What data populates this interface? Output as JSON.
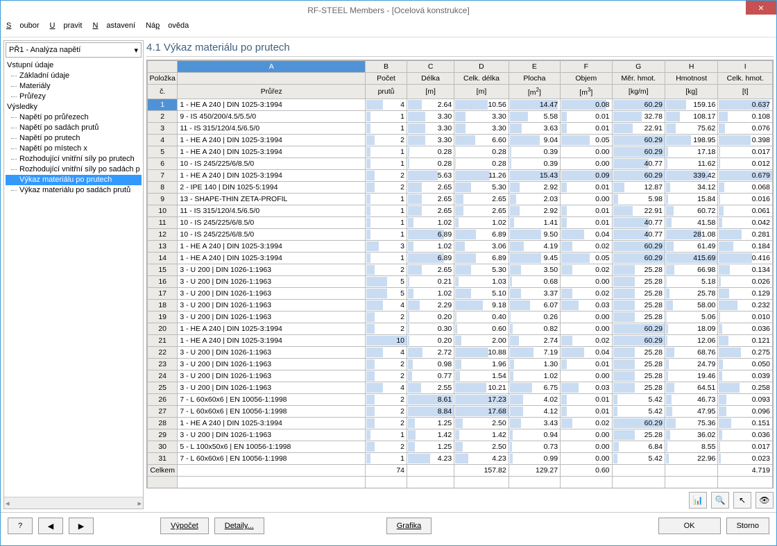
{
  "window": {
    "title": "RF-STEEL Members - [Ocelová konstrukce]"
  },
  "menu": {
    "soubor": "Soubor",
    "upravit": "Upravit",
    "nastaveni": "Nastavení",
    "napoveda": "Nápověda"
  },
  "combo": {
    "value": "PŘ1 - Analýza napětí"
  },
  "tree": {
    "vstup": "Vstupní údaje",
    "zaklad": "Základní údaje",
    "materialy": "Materiály",
    "prurezy": "Průřezy",
    "vysledky": "Výsledky",
    "np_prurez": "Napětí po průřezech",
    "np_sadach": "Napětí po sadách prutů",
    "np_prutech": "Napětí po prutech",
    "np_mistech": "Napětí po místech x",
    "roz_prutech": "Rozhodující vnitřní síly po prutech",
    "roz_sadach": "Rozhodující vnitřní síly po sadách p",
    "vykaz_prut": "Výkaz materiálu po prutech",
    "vykaz_sad": "Výkaz materiálu po sadách prutů"
  },
  "heading": "4.1 Výkaz materiálu po prutech",
  "cols": {
    "letters": [
      "",
      "A",
      "B",
      "C",
      "D",
      "E",
      "F",
      "G",
      "H",
      "I"
    ],
    "h1": [
      "Položka",
      "",
      "Počet",
      "Délka",
      "Celk. délka",
      "Plocha",
      "Objem",
      "Měr. hmot.",
      "Hmotnost",
      "Celk. hmot."
    ],
    "h2": [
      "č.",
      "Průřez",
      "prutů",
      "[m]",
      "[m]",
      "[m2]",
      "[m3]",
      "[kg/m]",
      "[kg]",
      "[t]"
    ]
  },
  "rows": [
    {
      "n": "1",
      "sec": "1 - HE A 240 | DIN 1025-3:1994",
      "cnt": "4",
      "len": "2.64",
      "tot": "10.56",
      "area": "14.47",
      "vol": "0.08",
      "unit": "60.29",
      "mass": "159.16",
      "tmass": "0.637"
    },
    {
      "n": "2",
      "sec": "9 - IS 450/200/4.5/5.5/0",
      "cnt": "1",
      "len": "3.30",
      "tot": "3.30",
      "area": "5.58",
      "vol": "0.01",
      "unit": "32.78",
      "mass": "108.17",
      "tmass": "0.108"
    },
    {
      "n": "3",
      "sec": "11 - IS 315/120/4.5/6.5/0",
      "cnt": "1",
      "len": "3.30",
      "tot": "3.30",
      "area": "3.63",
      "vol": "0.01",
      "unit": "22.91",
      "mass": "75.62",
      "tmass": "0.076"
    },
    {
      "n": "4",
      "sec": "1 - HE A 240 | DIN 1025-3:1994",
      "cnt": "2",
      "len": "3.30",
      "tot": "6.60",
      "area": "9.04",
      "vol": "0.05",
      "unit": "60.29",
      "mass": "198.95",
      "tmass": "0.398"
    },
    {
      "n": "5",
      "sec": "1 - HE A 240 | DIN 1025-3:1994",
      "cnt": "1",
      "len": "0.28",
      "tot": "0.28",
      "area": "0.39",
      "vol": "0.00",
      "unit": "60.29",
      "mass": "17.18",
      "tmass": "0.017"
    },
    {
      "n": "6",
      "sec": "10 - IS 245/225/6/8.5/0",
      "cnt": "1",
      "len": "0.28",
      "tot": "0.28",
      "area": "0.39",
      "vol": "0.00",
      "unit": "40.77",
      "mass": "11.62",
      "tmass": "0.012"
    },
    {
      "n": "7",
      "sec": "1 - HE A 240 | DIN 1025-3:1994",
      "cnt": "2",
      "len": "5.63",
      "tot": "11.26",
      "area": "15.43",
      "vol": "0.09",
      "unit": "60.29",
      "mass": "339.42",
      "tmass": "0.679"
    },
    {
      "n": "8",
      "sec": "2 - IPE 140 | DIN 1025-5:1994",
      "cnt": "2",
      "len": "2.65",
      "tot": "5.30",
      "area": "2.92",
      "vol": "0.01",
      "unit": "12.87",
      "mass": "34.12",
      "tmass": "0.068"
    },
    {
      "n": "9",
      "sec": "13 - SHAPE-THIN ZETA-PROFIL",
      "cnt": "1",
      "len": "2.65",
      "tot": "2.65",
      "area": "2.03",
      "vol": "0.00",
      "unit": "5.98",
      "mass": "15.84",
      "tmass": "0.016"
    },
    {
      "n": "10",
      "sec": "11 - IS 315/120/4.5/6.5/0",
      "cnt": "1",
      "len": "2.65",
      "tot": "2.65",
      "area": "2.92",
      "vol": "0.01",
      "unit": "22.91",
      "mass": "60.72",
      "tmass": "0.061"
    },
    {
      "n": "11",
      "sec": "10 - IS 245/225/6/8.5/0",
      "cnt": "1",
      "len": "1.02",
      "tot": "1.02",
      "area": "1.41",
      "vol": "0.01",
      "unit": "40.77",
      "mass": "41.58",
      "tmass": "0.042"
    },
    {
      "n": "12",
      "sec": "10 - IS 245/225/6/8.5/0",
      "cnt": "1",
      "len": "6.89",
      "tot": "6.89",
      "area": "9.50",
      "vol": "0.04",
      "unit": "40.77",
      "mass": "281.08",
      "tmass": "0.281"
    },
    {
      "n": "13",
      "sec": "1 - HE A 240 | DIN 1025-3:1994",
      "cnt": "3",
      "len": "1.02",
      "tot": "3.06",
      "area": "4.19",
      "vol": "0.02",
      "unit": "60.29",
      "mass": "61.49",
      "tmass": "0.184"
    },
    {
      "n": "14",
      "sec": "1 - HE A 240 | DIN 1025-3:1994",
      "cnt": "1",
      "len": "6.89",
      "tot": "6.89",
      "area": "9.45",
      "vol": "0.05",
      "unit": "60.29",
      "mass": "415.69",
      "tmass": "0.416"
    },
    {
      "n": "15",
      "sec": "3 - U 200 | DIN 1026-1:1963",
      "cnt": "2",
      "len": "2.65",
      "tot": "5.30",
      "area": "3.50",
      "vol": "0.02",
      "unit": "25.28",
      "mass": "66.98",
      "tmass": "0.134"
    },
    {
      "n": "16",
      "sec": "3 - U 200 | DIN 1026-1:1963",
      "cnt": "5",
      "len": "0.21",
      "tot": "1.03",
      "area": "0.68",
      "vol": "0.00",
      "unit": "25.28",
      "mass": "5.18",
      "tmass": "0.026"
    },
    {
      "n": "17",
      "sec": "3 - U 200 | DIN 1026-1:1963",
      "cnt": "5",
      "len": "1.02",
      "tot": "5.10",
      "area": "3.37",
      "vol": "0.02",
      "unit": "25.28",
      "mass": "25.78",
      "tmass": "0.129"
    },
    {
      "n": "18",
      "sec": "3 - U 200 | DIN 1026-1:1963",
      "cnt": "4",
      "len": "2.29",
      "tot": "9.18",
      "area": "6.07",
      "vol": "0.03",
      "unit": "25.28",
      "mass": "58.00",
      "tmass": "0.232"
    },
    {
      "n": "19",
      "sec": "3 - U 200 | DIN 1026-1:1963",
      "cnt": "2",
      "len": "0.20",
      "tot": "0.40",
      "area": "0.26",
      "vol": "0.00",
      "unit": "25.28",
      "mass": "5.06",
      "tmass": "0.010"
    },
    {
      "n": "20",
      "sec": "1 - HE A 240 | DIN 1025-3:1994",
      "cnt": "2",
      "len": "0.30",
      "tot": "0.60",
      "area": "0.82",
      "vol": "0.00",
      "unit": "60.29",
      "mass": "18.09",
      "tmass": "0.036"
    },
    {
      "n": "21",
      "sec": "1 - HE A 240 | DIN 1025-3:1994",
      "cnt": "10",
      "len": "0.20",
      "tot": "2.00",
      "area": "2.74",
      "vol": "0.02",
      "unit": "60.29",
      "mass": "12.06",
      "tmass": "0.121"
    },
    {
      "n": "22",
      "sec": "3 - U 200 | DIN 1026-1:1963",
      "cnt": "4",
      "len": "2.72",
      "tot": "10.88",
      "area": "7.19",
      "vol": "0.04",
      "unit": "25.28",
      "mass": "68.76",
      "tmass": "0.275"
    },
    {
      "n": "23",
      "sec": "3 - U 200 | DIN 1026-1:1963",
      "cnt": "2",
      "len": "0.98",
      "tot": "1.96",
      "area": "1.30",
      "vol": "0.01",
      "unit": "25.28",
      "mass": "24.79",
      "tmass": "0.050"
    },
    {
      "n": "24",
      "sec": "3 - U 200 | DIN 1026-1:1963",
      "cnt": "2",
      "len": "0.77",
      "tot": "1.54",
      "area": "1.02",
      "vol": "0.00",
      "unit": "25.28",
      "mass": "19.46",
      "tmass": "0.039"
    },
    {
      "n": "25",
      "sec": "3 - U 200 | DIN 1026-1:1963",
      "cnt": "4",
      "len": "2.55",
      "tot": "10.21",
      "area": "6.75",
      "vol": "0.03",
      "unit": "25.28",
      "mass": "64.51",
      "tmass": "0.258"
    },
    {
      "n": "26",
      "sec": "7 - L 60x60x6 | EN 10056-1:1998",
      "cnt": "2",
      "len": "8.61",
      "tot": "17.23",
      "area": "4.02",
      "vol": "0.01",
      "unit": "5.42",
      "mass": "46.73",
      "tmass": "0.093"
    },
    {
      "n": "27",
      "sec": "7 - L 60x60x6 | EN 10056-1:1998",
      "cnt": "2",
      "len": "8.84",
      "tot": "17.68",
      "area": "4.12",
      "vol": "0.01",
      "unit": "5.42",
      "mass": "47.95",
      "tmass": "0.096"
    },
    {
      "n": "28",
      "sec": "1 - HE A 240 | DIN 1025-3:1994",
      "cnt": "2",
      "len": "1.25",
      "tot": "2.50",
      "area": "3.43",
      "vol": "0.02",
      "unit": "60.29",
      "mass": "75.36",
      "tmass": "0.151"
    },
    {
      "n": "29",
      "sec": "3 - U 200 | DIN 1026-1:1963",
      "cnt": "1",
      "len": "1.42",
      "tot": "1.42",
      "area": "0.94",
      "vol": "0.00",
      "unit": "25.28",
      "mass": "36.02",
      "tmass": "0.036"
    },
    {
      "n": "30",
      "sec": "5 - L 100x50x6 | EN 10056-1:1998",
      "cnt": "2",
      "len": "1.25",
      "tot": "2.50",
      "area": "0.73",
      "vol": "0.00",
      "unit": "6.84",
      "mass": "8.55",
      "tmass": "0.017"
    },
    {
      "n": "31",
      "sec": "7 - L 60x60x6 | EN 10056-1:1998",
      "cnt": "1",
      "len": "4.23",
      "tot": "4.23",
      "area": "0.99",
      "vol": "0.00",
      "unit": "5.42",
      "mass": "22.96",
      "tmass": "0.023"
    }
  ],
  "sum": {
    "label": "Celkem",
    "cnt": "74",
    "tot": "157.82",
    "area": "129.27",
    "vol": "0.60",
    "tmass": "4.719"
  },
  "max": {
    "cnt": 10,
    "len": 8.84,
    "tot": 17.68,
    "area": 15.43,
    "vol": 0.09,
    "unit": 60.29,
    "mass": 415.69,
    "tmass": 0.679
  },
  "buttons": {
    "vypocet": "Výpočet",
    "detaily": "Detaily...",
    "grafika": "Grafika",
    "ok": "OK",
    "storno": "Storno"
  }
}
